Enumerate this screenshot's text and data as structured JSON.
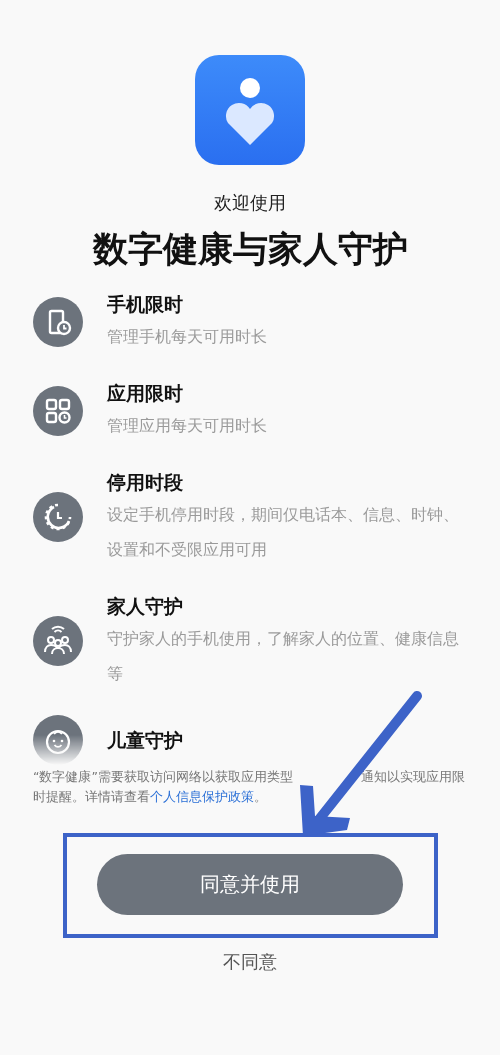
{
  "header": {
    "welcome": "欢迎使用",
    "title": "数字健康与家人守护"
  },
  "features": [
    {
      "kind": "phone-timer",
      "title": "手机限时",
      "description": "管理手机每天可用时长",
      "faded": false
    },
    {
      "kind": "apps-timer",
      "title": "应用限时",
      "description": "管理应用每天可用时长",
      "faded": false
    },
    {
      "kind": "downtime",
      "title": "停用时段",
      "description": "设定手机停用时段，期间仅电话本、信息、时钟、设置和不受限应用可用",
      "faded": false
    },
    {
      "kind": "family",
      "title": "家人守护",
      "description": "守护家人的手机使用，了解家人的位置、健康信息等",
      "faded": false
    },
    {
      "kind": "child",
      "title": "儿童守护",
      "faded": true
    }
  ],
  "notice": {
    "text_before": "“数字健康”需要获取访问网络以获取应用类型",
    "text_after": "通知以实现应用限时提醒。详情请查看",
    "link": "个人信息保护政策",
    "end": "。"
  },
  "buttons": {
    "agree": "同意并使用",
    "disagree": "不同意"
  }
}
